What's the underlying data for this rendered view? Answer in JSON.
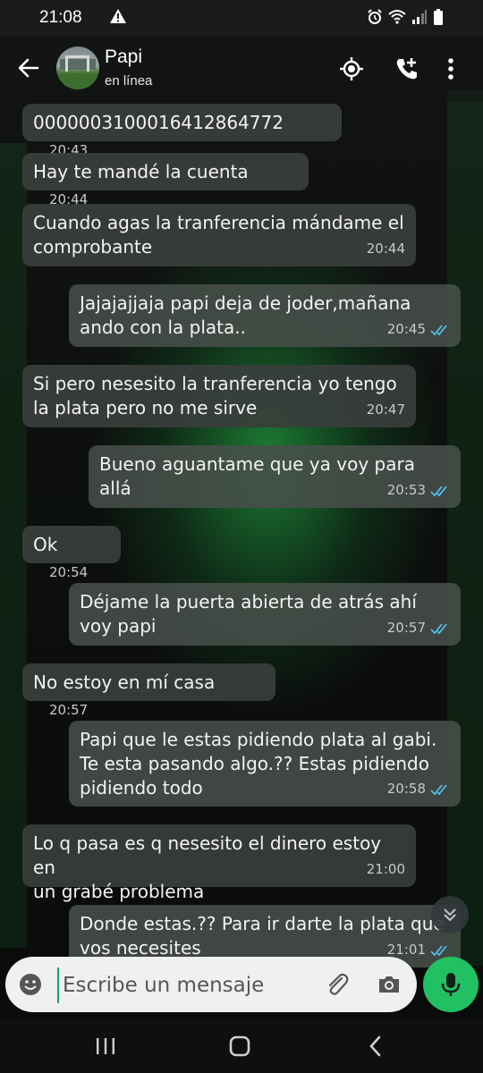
{
  "status_bar": {
    "time": "21:08"
  },
  "header": {
    "contact_name": "Papi",
    "contact_status": "en línea"
  },
  "messages": [
    {
      "dir": "in",
      "text": "0000003100016412864772",
      "time": "20:43"
    },
    {
      "dir": "in",
      "text": "Hay te mandé la cuenta",
      "time": "20:44"
    },
    {
      "dir": "in",
      "text": "Cuando agas la tranferencia mándame el\ncomprobante",
      "time": "20:44"
    },
    {
      "dir": "out",
      "text": "Jajajajjaja papi deja de joder,mañana\nando con la plata..",
      "time": "20:45"
    },
    {
      "dir": "in",
      "text": "Si pero nesesito la tranferencia yo tengo\nla plata pero no me sirve",
      "time": "20:47"
    },
    {
      "dir": "out",
      "text": "Bueno aguantame que ya voy para allá",
      "time": "20:53"
    },
    {
      "dir": "in",
      "text": "Ok",
      "time": "20:54"
    },
    {
      "dir": "out",
      "text": "Déjame la puerta abierta de atrás ahí\nvoy papi",
      "time": "20:57"
    },
    {
      "dir": "in",
      "text": "No estoy en mí casa",
      "time": "20:57"
    },
    {
      "dir": "out",
      "text": "Papi que le estas pidiendo plata al gabi.\nTe esta pasando algo.?? Estas pidiendo\npidiendo todo",
      "time": "20:58"
    },
    {
      "dir": "in",
      "text": "Lo q pasa es q nesesito el dinero estoy en\nun grabé problema",
      "time": "21:00"
    },
    {
      "dir": "out",
      "text": "Donde estas.?? Para ir darte la plata que\nvos necesites",
      "time": "21:01"
    }
  ],
  "composer": {
    "placeholder": "Escribe un mensaje"
  },
  "colors": {
    "accent": "#21c063",
    "read_ticks": "#53bdeb"
  }
}
